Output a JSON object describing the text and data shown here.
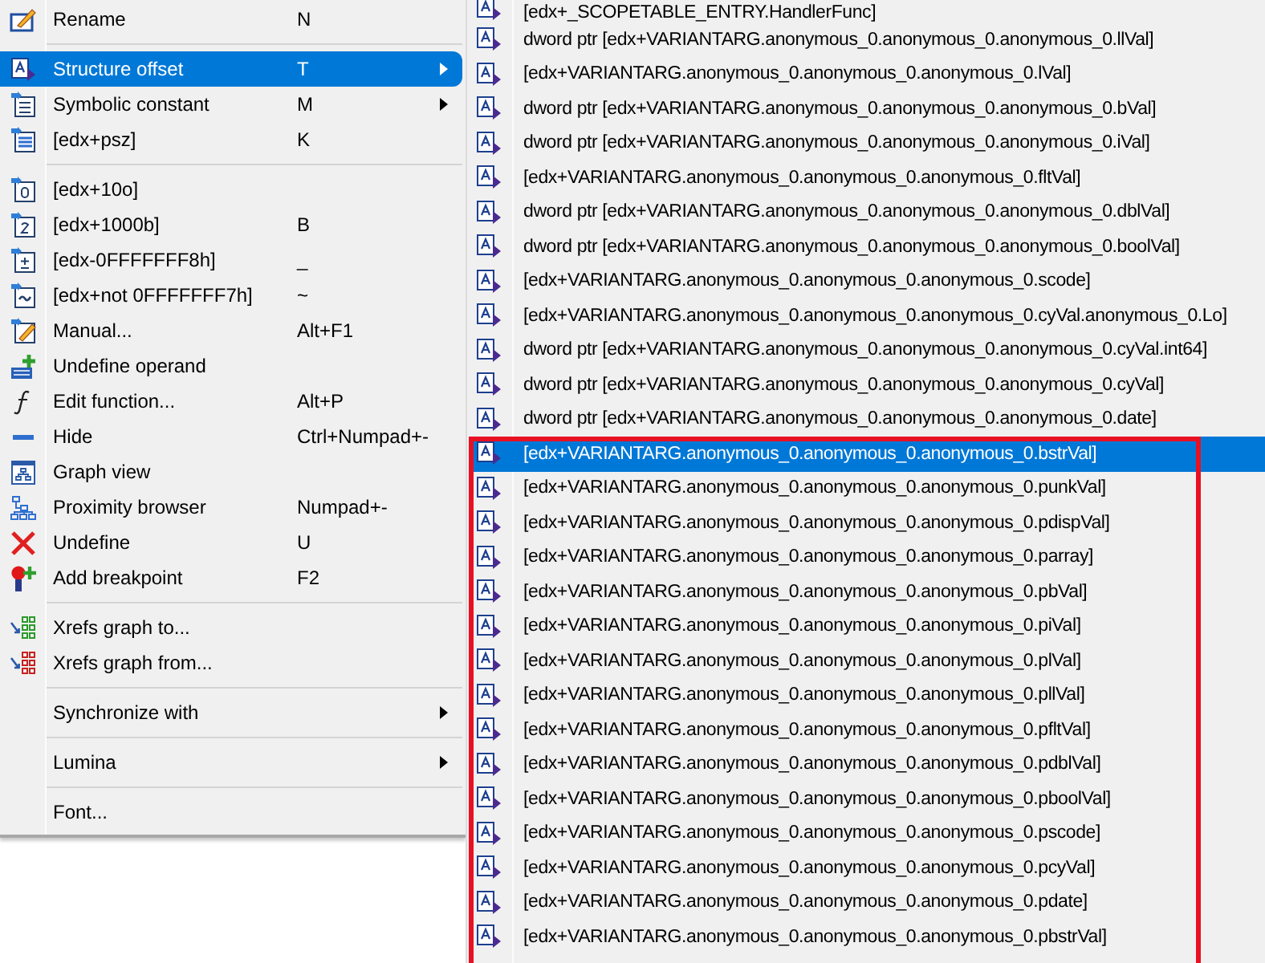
{
  "context_menu": {
    "items": [
      {
        "kind": "item",
        "label": "Rename",
        "shortcut": "N",
        "selected": false,
        "has_submenu": false
      },
      {
        "kind": "separator"
      },
      {
        "kind": "item",
        "label": "Structure offset",
        "shortcut": "T",
        "selected": true,
        "has_submenu": true
      },
      {
        "kind": "item",
        "label": "Symbolic constant",
        "shortcut": "M",
        "selected": false,
        "has_submenu": true
      },
      {
        "kind": "item",
        "label": "[edx+psz]",
        "shortcut": "K",
        "selected": false,
        "has_submenu": false
      },
      {
        "kind": "separator"
      },
      {
        "kind": "item",
        "label": "[edx+10o]",
        "selected": false,
        "has_submenu": false
      },
      {
        "kind": "item",
        "label": "[edx+1000b]",
        "shortcut": "B",
        "selected": false,
        "has_submenu": false
      },
      {
        "kind": "item",
        "label": "[edx-0FFFFFFF8h]",
        "shortcut": "_",
        "selected": false,
        "has_submenu": false
      },
      {
        "kind": "item",
        "label": "[edx+not 0FFFFFFF7h]",
        "shortcut": "~",
        "selected": false,
        "has_submenu": false
      },
      {
        "kind": "item",
        "label": "Manual...",
        "shortcut": "Alt+F1",
        "selected": false,
        "has_submenu": false
      },
      {
        "kind": "item",
        "label": "Undefine operand",
        "selected": false,
        "has_submenu": false
      },
      {
        "kind": "item",
        "label": "Edit function...",
        "shortcut": "Alt+P",
        "selected": false,
        "has_submenu": false
      },
      {
        "kind": "item",
        "label": "Hide",
        "shortcut": "Ctrl+Numpad+-",
        "selected": false,
        "has_submenu": false
      },
      {
        "kind": "item",
        "label": "Graph view",
        "selected": false,
        "has_submenu": false
      },
      {
        "kind": "item",
        "label": "Proximity browser",
        "shortcut": "Numpad+-",
        "selected": false,
        "has_submenu": false
      },
      {
        "kind": "item",
        "label": "Undefine",
        "shortcut": "U",
        "selected": false,
        "has_submenu": false
      },
      {
        "kind": "item",
        "label": "Add breakpoint",
        "shortcut": "F2",
        "selected": false,
        "has_submenu": false
      },
      {
        "kind": "separator"
      },
      {
        "kind": "item",
        "label": "Xrefs graph to...",
        "selected": false,
        "has_submenu": false
      },
      {
        "kind": "item",
        "label": "Xrefs graph from...",
        "selected": false,
        "has_submenu": false
      },
      {
        "kind": "separator"
      },
      {
        "kind": "item",
        "label": "Synchronize with",
        "selected": false,
        "has_submenu": true
      },
      {
        "kind": "separator"
      },
      {
        "kind": "item",
        "label": "Lumina",
        "selected": false,
        "has_submenu": true
      },
      {
        "kind": "separator"
      },
      {
        "kind": "item",
        "label": "Font...",
        "selected": false,
        "has_submenu": false
      }
    ]
  },
  "submenu": {
    "rows": [
      {
        "text": "[edx+_SCOPETABLE_ENTRY.HandlerFunc]",
        "selected": false,
        "framed": false
      },
      {
        "text": "dword ptr [edx+VARIANTARG.anonymous_0.anonymous_0.anonymous_0.llVal]",
        "selected": false,
        "framed": false
      },
      {
        "text": "[edx+VARIANTARG.anonymous_0.anonymous_0.anonymous_0.lVal]",
        "selected": false,
        "framed": false
      },
      {
        "text": "dword ptr [edx+VARIANTARG.anonymous_0.anonymous_0.anonymous_0.bVal]",
        "selected": false,
        "framed": false
      },
      {
        "text": "dword ptr [edx+VARIANTARG.anonymous_0.anonymous_0.anonymous_0.iVal]",
        "selected": false,
        "framed": false
      },
      {
        "text": "[edx+VARIANTARG.anonymous_0.anonymous_0.anonymous_0.fltVal]",
        "selected": false,
        "framed": false
      },
      {
        "text": "dword ptr [edx+VARIANTARG.anonymous_0.anonymous_0.anonymous_0.dblVal]",
        "selected": false,
        "framed": false
      },
      {
        "text": "dword ptr [edx+VARIANTARG.anonymous_0.anonymous_0.anonymous_0.boolVal]",
        "selected": false,
        "framed": false
      },
      {
        "text": "[edx+VARIANTARG.anonymous_0.anonymous_0.anonymous_0.scode]",
        "selected": false,
        "framed": false
      },
      {
        "text": "[edx+VARIANTARG.anonymous_0.anonymous_0.anonymous_0.cyVal.anonymous_0.Lo]",
        "selected": false,
        "framed": false
      },
      {
        "text": "dword ptr [edx+VARIANTARG.anonymous_0.anonymous_0.anonymous_0.cyVal.int64]",
        "selected": false,
        "framed": false
      },
      {
        "text": "dword ptr [edx+VARIANTARG.anonymous_0.anonymous_0.anonymous_0.cyVal]",
        "selected": false,
        "framed": false
      },
      {
        "text": "dword ptr [edx+VARIANTARG.anonymous_0.anonymous_0.anonymous_0.date]",
        "selected": false,
        "framed": false
      },
      {
        "text": "[edx+VARIANTARG.anonymous_0.anonymous_0.anonymous_0.bstrVal]",
        "selected": true,
        "framed": true
      },
      {
        "text": "[edx+VARIANTARG.anonymous_0.anonymous_0.anonymous_0.punkVal]",
        "selected": false,
        "framed": true
      },
      {
        "text": "[edx+VARIANTARG.anonymous_0.anonymous_0.anonymous_0.pdispVal]",
        "selected": false,
        "framed": true
      },
      {
        "text": "[edx+VARIANTARG.anonymous_0.anonymous_0.anonymous_0.parray]",
        "selected": false,
        "framed": true
      },
      {
        "text": "[edx+VARIANTARG.anonymous_0.anonymous_0.anonymous_0.pbVal]",
        "selected": false,
        "framed": true
      },
      {
        "text": "[edx+VARIANTARG.anonymous_0.anonymous_0.anonymous_0.piVal]",
        "selected": false,
        "framed": true
      },
      {
        "text": "[edx+VARIANTARG.anonymous_0.anonymous_0.anonymous_0.plVal]",
        "selected": false,
        "framed": true
      },
      {
        "text": "[edx+VARIANTARG.anonymous_0.anonymous_0.anonymous_0.pllVal]",
        "selected": false,
        "framed": true
      },
      {
        "text": "[edx+VARIANTARG.anonymous_0.anonymous_0.anonymous_0.pfltVal]",
        "selected": false,
        "framed": true
      },
      {
        "text": "[edx+VARIANTARG.anonymous_0.anonymous_0.anonymous_0.pdblVal]",
        "selected": false,
        "framed": true
      },
      {
        "text": "[edx+VARIANTARG.anonymous_0.anonymous_0.anonymous_0.pboolVal]",
        "selected": false,
        "framed": true
      },
      {
        "text": "[edx+VARIANTARG.anonymous_0.anonymous_0.anonymous_0.pscode]",
        "selected": false,
        "framed": true
      },
      {
        "text": "[edx+VARIANTARG.anonymous_0.anonymous_0.anonymous_0.pcyVal]",
        "selected": false,
        "framed": true
      },
      {
        "text": "[edx+VARIANTARG.anonymous_0.anonymous_0.anonymous_0.pdate]",
        "selected": false,
        "framed": true
      },
      {
        "text": "[edx+VARIANTARG.anonymous_0.anonymous_0.anonymous_0.pbstrVal]",
        "selected": false,
        "framed": true
      }
    ]
  }
}
